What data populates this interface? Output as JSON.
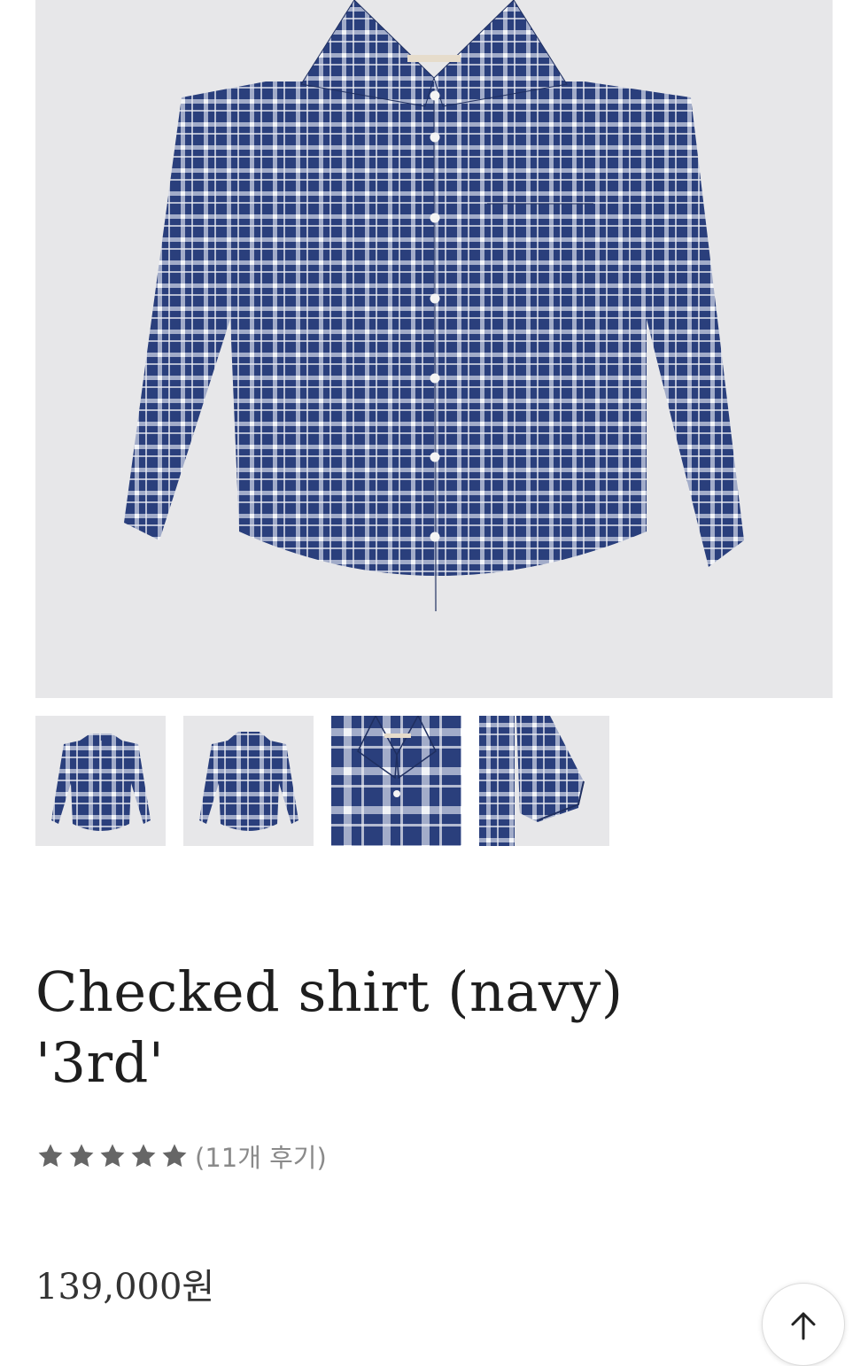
{
  "product": {
    "title_line1": "Checked shirt (navy)",
    "title_line2": "'3rd'",
    "rating": 5,
    "review_count_label": "(11개 후기)",
    "price": "139,000원"
  },
  "gallery": {
    "thumbnails": [
      {
        "name": "front-view"
      },
      {
        "name": "back-view"
      },
      {
        "name": "collar-detail"
      },
      {
        "name": "sleeve-detail"
      }
    ]
  },
  "colors": {
    "navy": "#2a3f7c",
    "background": "#e7e7e9",
    "star": "#666666"
  },
  "icons": {
    "rating": "star-icon",
    "scroll_top": "arrow-up-icon"
  }
}
